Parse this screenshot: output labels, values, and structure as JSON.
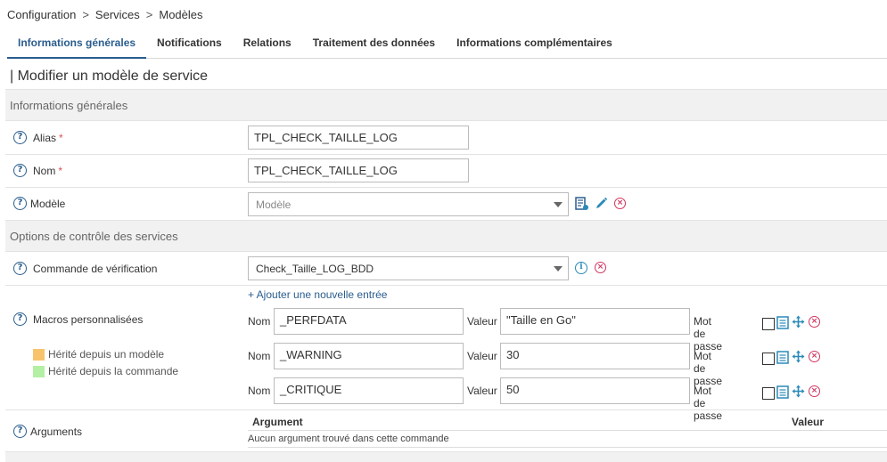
{
  "breadcrumb": {
    "items": [
      "Configuration",
      "Services",
      "Modèles"
    ],
    "separator": ">"
  },
  "tabs": [
    {
      "label": "Informations générales",
      "active": true
    },
    {
      "label": "Notifications",
      "active": false
    },
    {
      "label": "Relations",
      "active": false
    },
    {
      "label": "Traitement des données",
      "active": false
    },
    {
      "label": "Informations complémentaires",
      "active": false
    }
  ],
  "page_title": "| Modifier un modèle de service",
  "sections": {
    "general": "Informations générales",
    "control": "Options de contrôle des services"
  },
  "fields": {
    "alias": {
      "label": "Alias",
      "required_mark": "*",
      "value": "TPL_CHECK_TAILLE_LOG"
    },
    "nom": {
      "label": "Nom",
      "required_mark": "*",
      "value": "TPL_CHECK_TAILLE_LOG"
    },
    "modele": {
      "label": "Modèle",
      "placeholder": "Modèle"
    },
    "commande": {
      "label": "Commande de vérification",
      "value": "Check_Taille_LOG_BDD"
    }
  },
  "macros": {
    "label": "Macros personnalisées",
    "add_link": "+ Ajouter une nouvelle entrée",
    "name_label": "Nom",
    "value_label": "Valeur",
    "password_label": "Mot de passe",
    "rows": [
      {
        "name": "_PERFDATA",
        "value": "\"Taille en Go\""
      },
      {
        "name": "_WARNING",
        "value": "30"
      },
      {
        "name": "_CRITIQUE",
        "value": "50"
      }
    ],
    "legend": [
      {
        "label": "Hérité depuis un modèle",
        "color": "#f7c46c"
      },
      {
        "label": "Hérité depuis la commande",
        "color": "#b3f0a4"
      }
    ]
  },
  "arguments": {
    "label": "Arguments",
    "col_argument": "Argument",
    "col_valeur": "Valeur",
    "empty_text": "Aucun argument trouvé dans cette commande"
  },
  "colors": {
    "accent": "#2a5d8e",
    "delete": "#d0345e",
    "action": "#2a8ab8"
  }
}
